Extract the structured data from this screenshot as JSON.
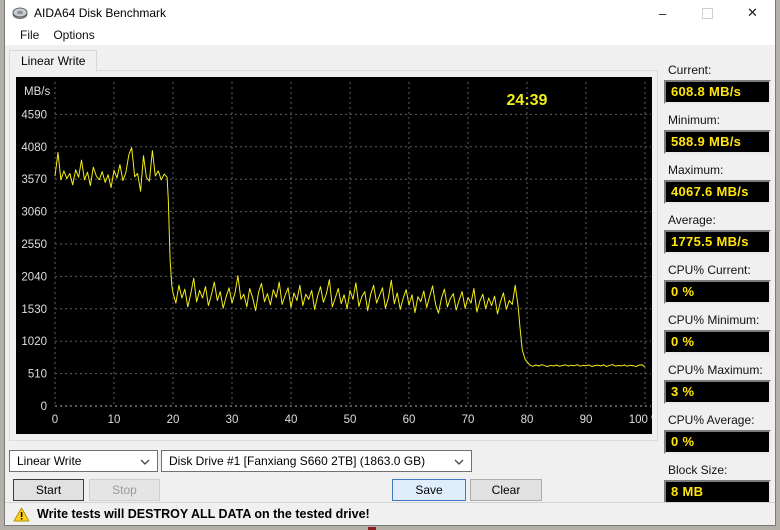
{
  "window": {
    "title": "AIDA64 Disk Benchmark"
  },
  "menu": {
    "items": [
      "File",
      "Options"
    ]
  },
  "tab": {
    "label": "Linear Write"
  },
  "chart_data": {
    "type": "line",
    "series_name": "Linear Write speed",
    "unit_label": "MB/s",
    "elapsed_time": "24:39",
    "xlim": [
      0,
      100
    ],
    "ylim": [
      0,
      5100
    ],
    "y_ticks": [
      0,
      510,
      1020,
      1530,
      2040,
      2550,
      3060,
      3570,
      4080,
      4590
    ],
    "x_ticks": [
      0,
      10,
      20,
      30,
      40,
      50,
      60,
      70,
      80,
      90,
      100
    ],
    "x_tick_labels": [
      "0",
      "10",
      "20",
      "30",
      "40",
      "50",
      "60",
      "70",
      "80",
      "90",
      "100 %"
    ],
    "grid": true,
    "line_color": "#f3ee14",
    "label_color": "#dedede",
    "points": [
      [
        0,
        3620
      ],
      [
        0.5,
        3990
      ],
      [
        1,
        3560
      ],
      [
        1.5,
        3700
      ],
      [
        2,
        3580
      ],
      [
        2.5,
        3660
      ],
      [
        3,
        3480
      ],
      [
        3.5,
        3720
      ],
      [
        4,
        3600
      ],
      [
        4.5,
        3870
      ],
      [
        5,
        3560
      ],
      [
        5.5,
        3680
      ],
      [
        6,
        3470
      ],
      [
        6.5,
        3760
      ],
      [
        7,
        3620
      ],
      [
        7.5,
        3560
      ],
      [
        8,
        3690
      ],
      [
        8.5,
        3520
      ],
      [
        9,
        3640
      ],
      [
        9.5,
        3440
      ],
      [
        10,
        3710
      ],
      [
        10.5,
        3590
      ],
      [
        11,
        3800
      ],
      [
        11.5,
        3550
      ],
      [
        12,
        3670
      ],
      [
        12.5,
        3950
      ],
      [
        13,
        4068
      ],
      [
        13.5,
        3610
      ],
      [
        14,
        3660
      ],
      [
        14.5,
        3380
      ],
      [
        15,
        3940
      ],
      [
        15.5,
        3600
      ],
      [
        16,
        3540
      ],
      [
        16.5,
        4020
      ],
      [
        17,
        3620
      ],
      [
        17.5,
        3700
      ],
      [
        18,
        3560
      ],
      [
        18.5,
        3650
      ],
      [
        19,
        3600
      ],
      [
        19.2,
        3250
      ],
      [
        19.5,
        2300
      ],
      [
        19.8,
        1900
      ],
      [
        20,
        1780
      ],
      [
        20.5,
        1620
      ],
      [
        21,
        1900
      ],
      [
        21.5,
        1700
      ],
      [
        22,
        1840
      ],
      [
        22.5,
        1560
      ],
      [
        23,
        1760
      ],
      [
        23.5,
        2010
      ],
      [
        24,
        1640
      ],
      [
        24.5,
        1820
      ],
      [
        25,
        1700
      ],
      [
        25.5,
        1880
      ],
      [
        26,
        1580
      ],
      [
        26.5,
        1750
      ],
      [
        27,
        1950
      ],
      [
        27.5,
        1660
      ],
      [
        28,
        1800
      ],
      [
        28.5,
        1540
      ],
      [
        29,
        1720
      ],
      [
        29.5,
        1860
      ],
      [
        30,
        1620
      ],
      [
        30.5,
        1780
      ],
      [
        31,
        2050
      ],
      [
        31.5,
        1680
      ],
      [
        32,
        1760
      ],
      [
        32.5,
        1560
      ],
      [
        33,
        1850
      ],
      [
        33.5,
        1700
      ],
      [
        34,
        1500
      ],
      [
        34.5,
        1790
      ],
      [
        35,
        1930
      ],
      [
        35.5,
        1640
      ],
      [
        36,
        1770
      ],
      [
        36.5,
        1590
      ],
      [
        37,
        1830
      ],
      [
        37.5,
        1710
      ],
      [
        38,
        1950
      ],
      [
        38.5,
        1600
      ],
      [
        39,
        1740
      ],
      [
        39.5,
        1860
      ],
      [
        40,
        1550
      ],
      [
        40.5,
        1780
      ],
      [
        41,
        1660
      ],
      [
        41.5,
        1900
      ],
      [
        42,
        1580
      ],
      [
        42.5,
        1760
      ],
      [
        43,
        1680
      ],
      [
        43.5,
        1820
      ],
      [
        44,
        1520
      ],
      [
        44.5,
        1730
      ],
      [
        45,
        1880
      ],
      [
        45.5,
        1630
      ],
      [
        46,
        1770
      ],
      [
        46.5,
        1990
      ],
      [
        47,
        1560
      ],
      [
        47.5,
        1700
      ],
      [
        48,
        1850
      ],
      [
        48.5,
        1610
      ],
      [
        49,
        1750
      ],
      [
        49.5,
        1530
      ],
      [
        50,
        1820
      ],
      [
        50.5,
        1680
      ],
      [
        51,
        1940
      ],
      [
        51.5,
        1570
      ],
      [
        52,
        1720
      ],
      [
        52.5,
        1800
      ],
      [
        53,
        1500
      ],
      [
        53.5,
        1760
      ],
      [
        54,
        1900
      ],
      [
        54.5,
        1620
      ],
      [
        55,
        1740
      ],
      [
        55.5,
        1860
      ],
      [
        56,
        1540
      ],
      [
        56.5,
        1700
      ],
      [
        57,
        1980
      ],
      [
        57.5,
        1610
      ],
      [
        58,
        1780
      ],
      [
        58.5,
        1520
      ],
      [
        59,
        1690
      ],
      [
        59.5,
        1830
      ],
      [
        60,
        1590
      ],
      [
        60.5,
        1750
      ],
      [
        61,
        1470
      ],
      [
        61.5,
        1720
      ],
      [
        62,
        1640
      ],
      [
        62.5,
        1810
      ],
      [
        63,
        1550
      ],
      [
        63.5,
        1730
      ],
      [
        64,
        1890
      ],
      [
        64.5,
        1600
      ],
      [
        65,
        1460
      ],
      [
        65.5,
        1700
      ],
      [
        66,
        1840
      ],
      [
        66.5,
        1560
      ],
      [
        67,
        1690
      ],
      [
        67.5,
        1770
      ],
      [
        68,
        1510
      ],
      [
        68.5,
        1670
      ],
      [
        69,
        1800
      ],
      [
        69.5,
        1540
      ],
      [
        70,
        1710
      ],
      [
        70.5,
        1620
      ],
      [
        71,
        1850
      ],
      [
        71.5,
        1480
      ],
      [
        72,
        1650
      ],
      [
        72.5,
        1760
      ],
      [
        73,
        1530
      ],
      [
        73.5,
        1700
      ],
      [
        74,
        1580
      ],
      [
        74.5,
        1730
      ],
      [
        75,
        1450
      ],
      [
        75.5,
        1640
      ],
      [
        76,
        1780
      ],
      [
        76.5,
        1520
      ],
      [
        77,
        1660
      ],
      [
        77.5,
        1600
      ],
      [
        78,
        1900
      ],
      [
        78.5,
        1560
      ],
      [
        78.8,
        1250
      ],
      [
        79.2,
        880
      ],
      [
        79.7,
        730
      ],
      [
        80.2,
        675
      ],
      [
        80.5,
        640
      ],
      [
        81,
        625
      ],
      [
        81.5,
        645
      ],
      [
        82,
        630
      ],
      [
        82.5,
        650
      ],
      [
        83,
        635
      ],
      [
        83.5,
        620
      ],
      [
        84,
        640
      ],
      [
        84.5,
        630
      ],
      [
        85,
        645
      ],
      [
        85.5,
        625
      ],
      [
        86,
        638
      ],
      [
        86.5,
        648
      ],
      [
        87,
        628
      ],
      [
        87.5,
        642
      ],
      [
        88,
        632
      ],
      [
        88.5,
        650
      ],
      [
        89,
        626
      ],
      [
        89.5,
        640
      ],
      [
        90,
        634
      ],
      [
        90.5,
        646
      ],
      [
        91,
        624
      ],
      [
        91.5,
        636
      ],
      [
        92,
        644
      ],
      [
        92.5,
        630
      ],
      [
        93,
        648
      ],
      [
        93.5,
        622
      ],
      [
        94,
        640
      ],
      [
        94.5,
        652
      ],
      [
        95,
        628
      ],
      [
        95.5,
        638
      ],
      [
        96,
        632
      ],
      [
        96.5,
        646
      ],
      [
        97,
        626
      ],
      [
        97.5,
        642
      ],
      [
        98,
        634
      ],
      [
        98.5,
        620
      ],
      [
        99,
        644
      ],
      [
        99.5,
        650
      ],
      [
        100,
        609
      ]
    ]
  },
  "stats": [
    {
      "label": "Current:",
      "value": "608.8 MB/s"
    },
    {
      "label": "Minimum:",
      "value": "588.9 MB/s"
    },
    {
      "label": "Maximum:",
      "value": "4067.6 MB/s"
    },
    {
      "label": "Average:",
      "value": "1775.5 MB/s"
    },
    {
      "label": "CPU% Current:",
      "value": "0 %"
    },
    {
      "label": "CPU% Minimum:",
      "value": "0 %"
    },
    {
      "label": "CPU% Maximum:",
      "value": "3 %"
    },
    {
      "label": "CPU% Average:",
      "value": "0 %"
    },
    {
      "label": "Block Size:",
      "value": "8 MB"
    }
  ],
  "controls": {
    "test_type": "Linear Write",
    "drive": "Disk Drive #1  [Fanxiang S660 2TB]  (1863.0 GB)",
    "start_label": "Start",
    "stop_label": "Stop",
    "save_label": "Save",
    "clear_label": "Clear"
  },
  "status": {
    "warning": "Write tests will DESTROY ALL DATA on the tested drive!"
  },
  "colors": {
    "accent_yellow": "#ffe606",
    "chart_bg": "#000000",
    "save_highlight": "#e0eefb"
  }
}
